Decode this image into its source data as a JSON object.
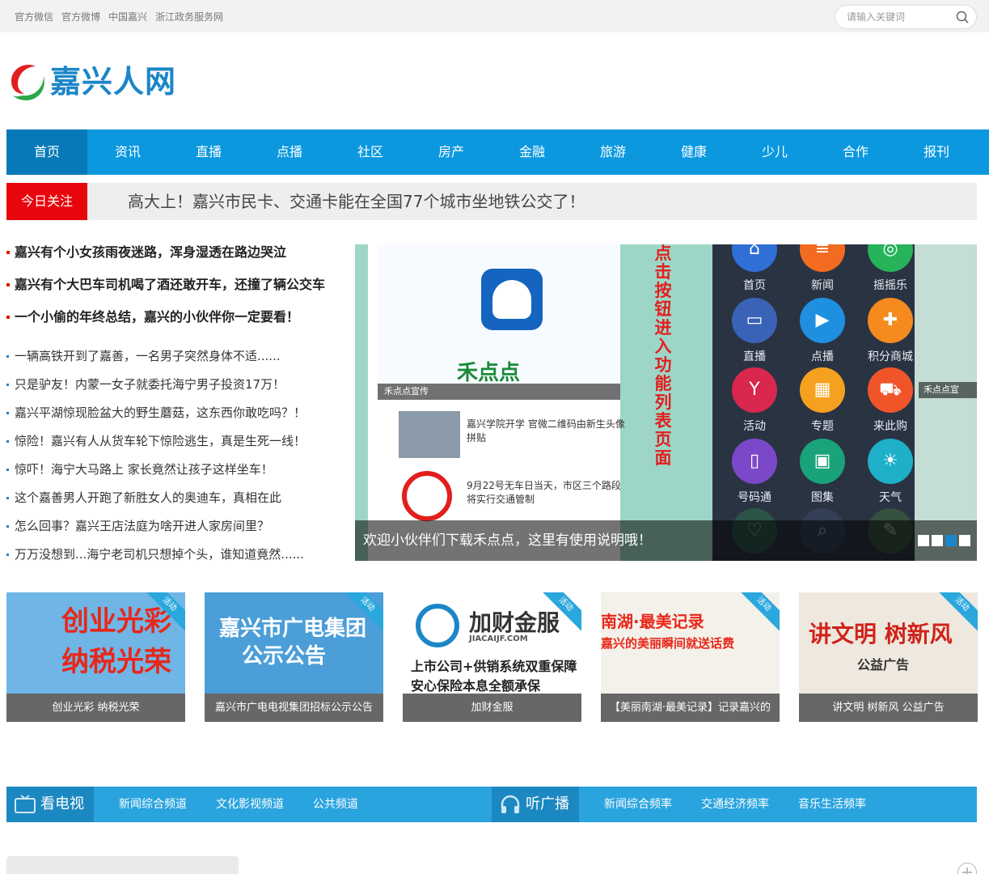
{
  "topbar": {
    "links": [
      "官方微信",
      "官方微博",
      "中国嘉兴",
      "浙江政务服务网"
    ],
    "search_placeholder": "请输入关键词"
  },
  "logo": {
    "text": "嘉兴人网"
  },
  "nav": {
    "items": [
      "首页",
      "资讯",
      "直播",
      "点播",
      "社区",
      "房产",
      "金融",
      "旅游",
      "健康",
      "少儿",
      "合作",
      "报刊"
    ],
    "active": "首页"
  },
  "today": {
    "badge": "今日关注",
    "headline": "高大上！嘉兴市民卡、交通卡能在全国77个城市坐地铁公交了！"
  },
  "headlines": [
    "嘉兴有个小女孩雨夜迷路，浑身湿透在路边哭泣",
    "嘉兴有个大巴车司机喝了酒还敢开车，还撞了辆公交车",
    "一个小偷的年终总结，嘉兴的小伙伴你一定要看！"
  ],
  "news": [
    "一辆高铁开到了嘉善，一名男子突然身体不适......",
    "只是驴友！内蒙一女子就委托海宁男子投资17万！",
    "嘉兴平湖惊现脸盆大的野生蘑菇，这东西你敢吃吗？！",
    "惊险！嘉兴有人从货车轮下惊险逃生，真是生死一线！",
    "惊吓！海宁大马路上 家长竟然让孩子这样坐车！",
    "这个嘉善男人开跑了新胜女人的奥迪车，真相在此",
    "怎么回事？嘉兴王店法庭为啥开进人家房间里？",
    "万万没想到...海宁老司机只想掉个头，谁知道竟然......"
  ],
  "slider": {
    "left_screen": {
      "brand": "禾点点",
      "caption": "禾点点宣传",
      "items": [
        "嘉兴学院开学 官微二维码由新生头像拼贴",
        "9月22号无车日当天，市区三个路段将实行交通管制"
      ]
    },
    "vertical_title": "点击按钮进入功能列表页面",
    "apps": [
      {
        "label": "首页",
        "color": "#2f6fd6",
        "icon": "home-icon",
        "glyph": "⌂"
      },
      {
        "label": "新闻",
        "color": "#f26b21",
        "icon": "news-icon",
        "glyph": "≡"
      },
      {
        "label": "摇摇乐",
        "color": "#27b35a",
        "icon": "shake-icon",
        "glyph": "◎"
      },
      {
        "label": "直播",
        "color": "#3a63b8",
        "icon": "monitor-icon",
        "glyph": "▭"
      },
      {
        "label": "点播",
        "color": "#1f8fe0",
        "icon": "play-icon",
        "glyph": "▶"
      },
      {
        "label": "积分商城",
        "color": "#f58a1f",
        "icon": "gift-icon",
        "glyph": "✚"
      },
      {
        "label": "活动",
        "color": "#d9274f",
        "icon": "cocktail-icon",
        "glyph": "Y"
      },
      {
        "label": "专题",
        "color": "#f5a11f",
        "icon": "grid-icon",
        "glyph": "▦"
      },
      {
        "label": "来此购",
        "color": "#f0552a",
        "icon": "cart-icon",
        "glyph": "⛟"
      },
      {
        "label": "号码通",
        "color": "#7b48c9",
        "icon": "phone-icon",
        "glyph": "▯"
      },
      {
        "label": "图集",
        "color": "#1aa37a",
        "icon": "image-icon",
        "glyph": "▣"
      },
      {
        "label": "天气",
        "color": "#1db0c8",
        "icon": "sun-icon",
        "glyph": "☀"
      }
    ],
    "side_caption": "禾点点宣",
    "caption": "欢迎小伙伴们下载禾点点，这里有使用说明哦！",
    "dots": 4,
    "active_dot": 3
  },
  "cards": [
    {
      "title": "创业光彩 纳税光荣",
      "big1": "创业光彩",
      "big2": "纳税光荣",
      "tag": "活动",
      "bg": "#6fb6e6"
    },
    {
      "title": "嘉兴市广电电视集团招标公示公告",
      "big1": "嘉兴市广电集团",
      "big2": "公示公告",
      "tag": "活动",
      "bg": "#4b9ed8"
    },
    {
      "title": "加财金服",
      "big1": "加财金服",
      "big2": "JIACAIJF.COM",
      "line1": "上市公司+供销系统双重保障",
      "line2": "安心保险本息全额承保",
      "tag": "活动",
      "bg": "#ffffff"
    },
    {
      "title": "【美丽南湖·最美记录】记录嘉兴的",
      "big1": "南湖·最美记录",
      "big2": "嘉兴的美丽瞬间就送话费",
      "tag": "活动",
      "bg": "#f4f1ea"
    },
    {
      "title": "讲文明 树新风 公益广告",
      "big1": "讲文明 树新风",
      "big2": "公益广告",
      "tag": "活动",
      "bg": "#efe8de"
    }
  ],
  "tv": {
    "tv_label": "看电视",
    "tv_links": [
      "新闻综合频道",
      "文化影视频道",
      "公共频道"
    ],
    "radio_label": "听广播",
    "radio_links": [
      "新闻综合频率",
      "交通经济频率",
      "音乐生活频率"
    ]
  }
}
